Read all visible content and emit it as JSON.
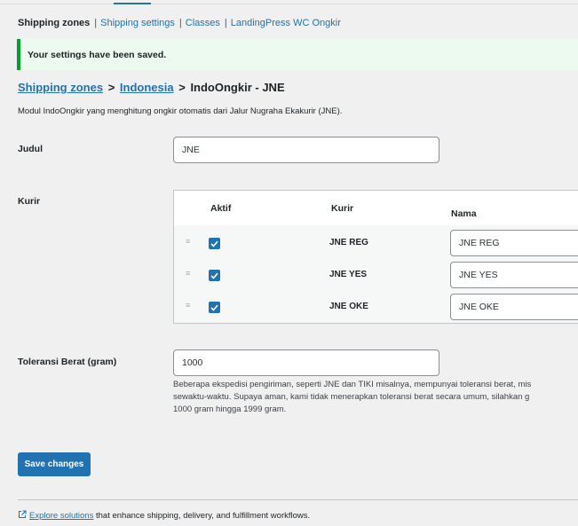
{
  "subnav": {
    "items": [
      "Shipping zones",
      "Shipping settings",
      "Classes",
      "LandingPress WC Ongkir"
    ],
    "separator": "|"
  },
  "notice": {
    "text": "Your settings have been saved."
  },
  "breadcrumb": {
    "link1": "Shipping zones",
    "link2": "Indonesia",
    "current": "IndoOngkir - JNE",
    "separator": ">"
  },
  "description": "Modul IndoOngkir yang menghitung ongkir otomatis dari Jalur Nugraha Ekakurir (JNE).",
  "fields": {
    "judul": {
      "label": "Judul",
      "value": "JNE"
    },
    "kurir": {
      "label": "Kurir",
      "headers": {
        "aktif": "Aktif",
        "kurir": "Kurir",
        "nama": "Nama"
      },
      "rows": [
        {
          "checked": true,
          "kurir": "JNE REG",
          "nama": "JNE REG"
        },
        {
          "checked": true,
          "kurir": "JNE YES",
          "nama": "JNE YES"
        },
        {
          "checked": true,
          "kurir": "JNE OKE",
          "nama": "JNE OKE"
        }
      ]
    },
    "toleransi": {
      "label": "Toleransi Berat (gram)",
      "value": "1000",
      "help": [
        "Beberapa ekspedisi pengiriman, seperti JNE dan TIKI misalnya, mempunyai toleransi berat, mis",
        "sewaktu-waktu. Supaya aman, kami tidak menerapkan toleransi berat secara umum, silahkan g",
        "1000 gram hingga 1999 gram."
      ]
    }
  },
  "save_button": "Save changes",
  "footer": {
    "icon": "external-link-icon",
    "link": "Explore solutions",
    "text": " that enhance shipping, delivery, and fulfillment workflows."
  },
  "colors": {
    "accent": "#2271b1",
    "notice_border": "#00a32a",
    "notice_bg": "#edfaef",
    "page_bg": "#f0f0f1"
  }
}
